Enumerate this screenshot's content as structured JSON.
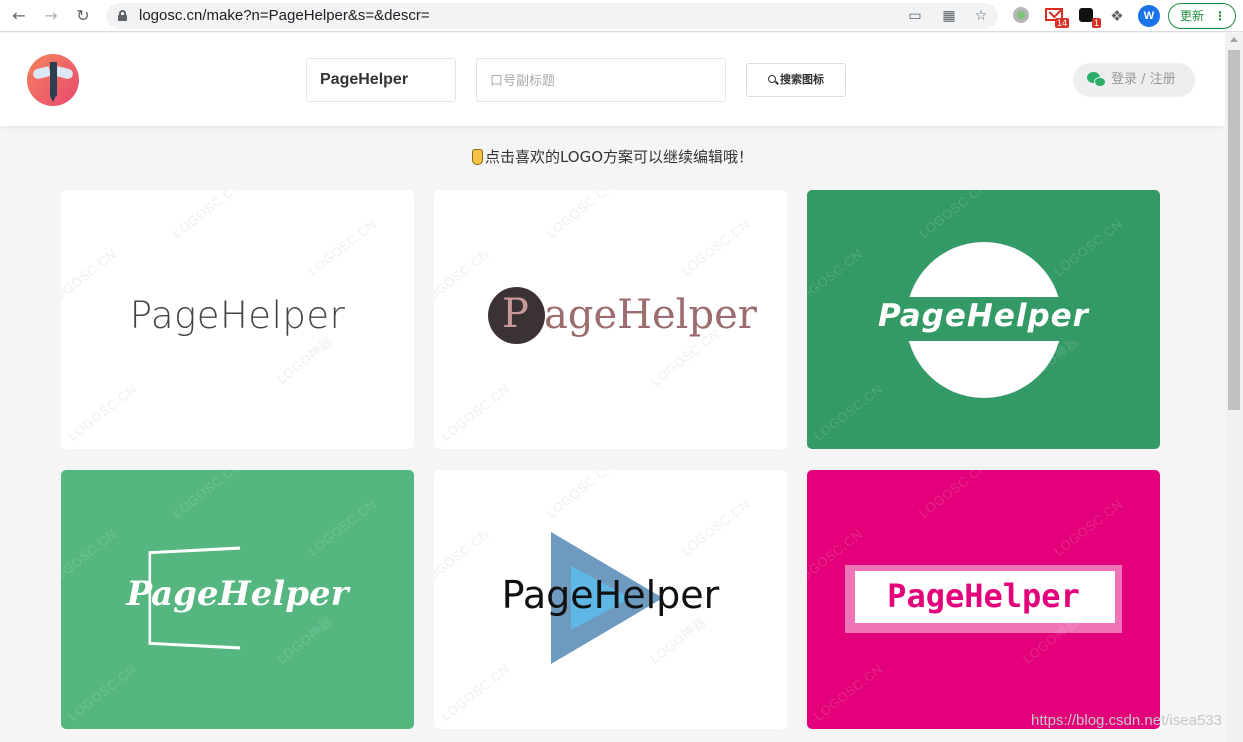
{
  "browser": {
    "url": "logosc.cn/make?n=PageHelper&s=&descr=",
    "gmail_badge": "14",
    "ext_badge": "1",
    "profile_initial": "W",
    "update_label": "更新"
  },
  "header": {
    "name_value": "PageHelper",
    "slogan_placeholder": "口号副标题",
    "search_label": "搜索图标",
    "login_label": "登录 / 注册"
  },
  "hint": "点击喜欢的LOGO方案可以继续编辑哦！",
  "watermarks": [
    "LOGOSC.CN",
    "LOGO神器"
  ],
  "cards": [
    {
      "text": "PageHelper",
      "bg": "#ffffff"
    },
    {
      "letter": "P",
      "text": "ageHelper",
      "bg": "#ffffff"
    },
    {
      "text": "PageHelper",
      "bg": "#349a65"
    },
    {
      "text": "PageHelper",
      "bg": "#55b77f"
    },
    {
      "text": "PageHelper",
      "bg": "#ffffff"
    },
    {
      "text": "PageHelper",
      "bg": "#e4007a"
    }
  ],
  "csdn_watermark": "https://blog.csdn.net/isea533"
}
